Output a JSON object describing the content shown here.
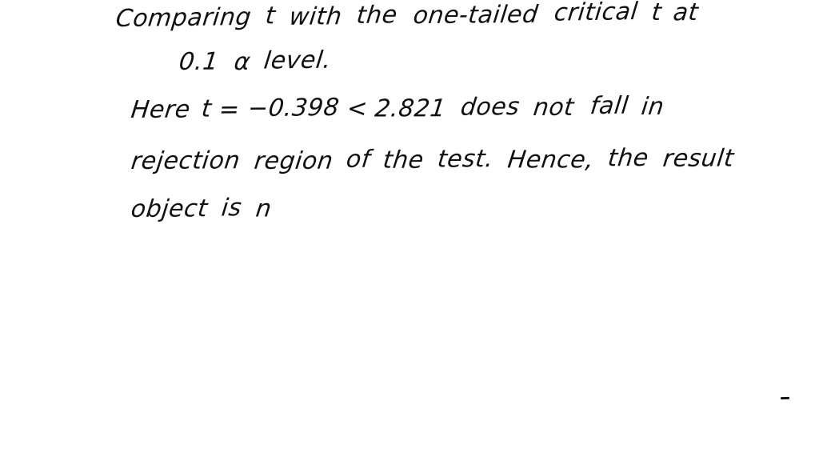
{
  "document": {
    "medium": "handwritten-note",
    "paper_color": "#ffffff",
    "ink_color": "#111111",
    "subject": "hypothesis-test-conclusion"
  },
  "lines": [
    {
      "id": "line-1",
      "text": "Comparing t with the one-tailed critical t at",
      "words": [
        "Comparing",
        "t",
        "with",
        "the",
        "one-tailed",
        "critical",
        "t",
        "at"
      ]
    },
    {
      "id": "line-2",
      "text": "0.1 α level.",
      "words": [
        "0.1",
        "α",
        "level."
      ]
    },
    {
      "id": "line-3",
      "text": "Here t = -0.398 < 2.821 does not fall in",
      "words": [
        "Here",
        "t",
        "=",
        "−0.398",
        "<",
        "2.821",
        "does",
        "not",
        "fall",
        "in"
      ]
    },
    {
      "id": "line-4",
      "text": "rejection region of the test. Hence, the result",
      "words": [
        "rejection",
        "region",
        "of",
        "the",
        "test.",
        "Hence,",
        "the",
        "result"
      ]
    },
    {
      "id": "line-5",
      "text": "object is n",
      "words": [
        "object",
        "is",
        "n"
      ]
    }
  ],
  "values": {
    "alpha_level": "0.1",
    "alpha_symbol": "α",
    "t_statistic": "−0.398",
    "critical_t": "2.821",
    "comparison_operator": "<",
    "tail_type": "one-tailed"
  },
  "marks": {
    "stray_dash": "-"
  }
}
